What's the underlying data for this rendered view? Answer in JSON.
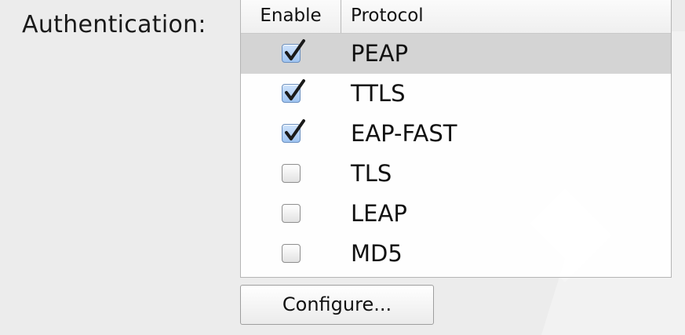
{
  "section": {
    "label": "Authentication:"
  },
  "table": {
    "headers": {
      "enable": "Enable",
      "protocol": "Protocol"
    },
    "rows": [
      {
        "protocol": "PEAP",
        "enabled": true,
        "selected": true
      },
      {
        "protocol": "TTLS",
        "enabled": true,
        "selected": false
      },
      {
        "protocol": "EAP-FAST",
        "enabled": true,
        "selected": false
      },
      {
        "protocol": "TLS",
        "enabled": false,
        "selected": false
      },
      {
        "protocol": "LEAP",
        "enabled": false,
        "selected": false
      },
      {
        "protocol": "MD5",
        "enabled": false,
        "selected": false
      }
    ]
  },
  "buttons": {
    "configure": "Configure..."
  },
  "colors": {
    "window_background": "#ececec",
    "selected_row": "#d4d4d4",
    "checkbox_checked_fill": "#a9cbf3"
  }
}
